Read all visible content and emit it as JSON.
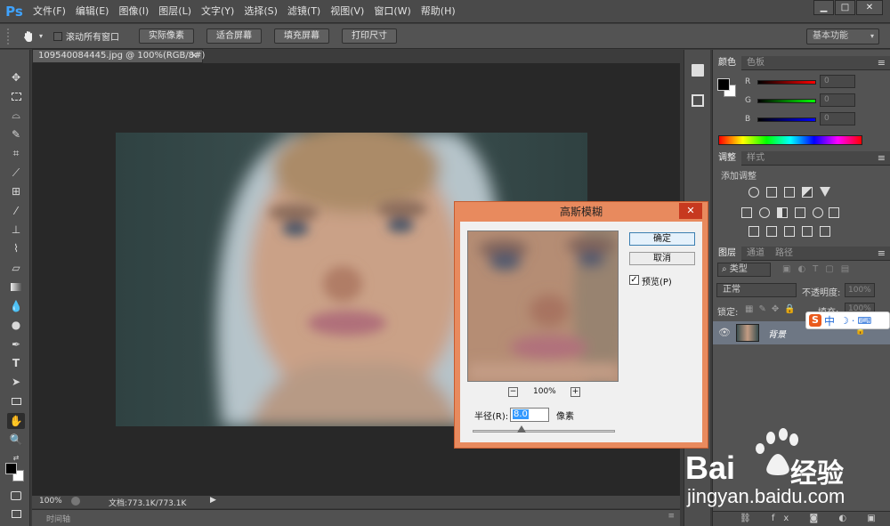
{
  "app": {
    "logo": "Ps"
  },
  "menu": [
    "文件(F)",
    "编辑(E)",
    "图像(I)",
    "图层(L)",
    "文字(Y)",
    "选择(S)",
    "滤镜(T)",
    "视图(V)",
    "窗口(W)",
    "帮助(H)"
  ],
  "window_controls": {
    "minimize": "▁",
    "maximize": "□",
    "close": "✕"
  },
  "options_bar": {
    "hand_icon": "hand-icon",
    "scroll_all_label": "滚动所有窗口",
    "buttons": [
      "实际像素",
      "适合屏幕",
      "填充屏幕",
      "打印尺寸"
    ],
    "workspace": "基本功能"
  },
  "document": {
    "tab_title": "109540084445.jpg @ 100%(RGB/8#)",
    "tab_close": "×",
    "zoom": "100%",
    "doc_size": "文档:773.1K/773.1K",
    "timeline": "时间轴"
  },
  "panels": {
    "color": {
      "tabs": [
        "颜色",
        "色板"
      ],
      "labels": [
        "R",
        "G",
        "B"
      ],
      "values": [
        "0",
        "0",
        "0"
      ]
    },
    "adjustments": {
      "tabs": [
        "调整",
        "样式"
      ],
      "add_label": "添加调整"
    },
    "layers": {
      "tabs": [
        "图层",
        "通道",
        "路径"
      ],
      "kind": "类型",
      "blend_mode": "正常",
      "opacity_label": "不透明度:",
      "opacity_value": "100%",
      "lock_label": "锁定:",
      "fill_label": "填充:",
      "fill_value": "100%",
      "layer_name": "背景"
    }
  },
  "ime": {
    "icon": "S",
    "text": "中"
  },
  "dialog": {
    "title": "高斯模糊",
    "close": "✕",
    "ok": "确定",
    "cancel": "取消",
    "preview_label": "预览(P)",
    "preview_checked": true,
    "zoom": "100%",
    "zoom_out": "−",
    "zoom_in": "+",
    "radius_label": "半径(R):",
    "radius_value": "8.0",
    "unit": "像素"
  },
  "watermark": {
    "brand": "Bai",
    "brand2": "经验",
    "url": "jingyan.baidu.com"
  }
}
